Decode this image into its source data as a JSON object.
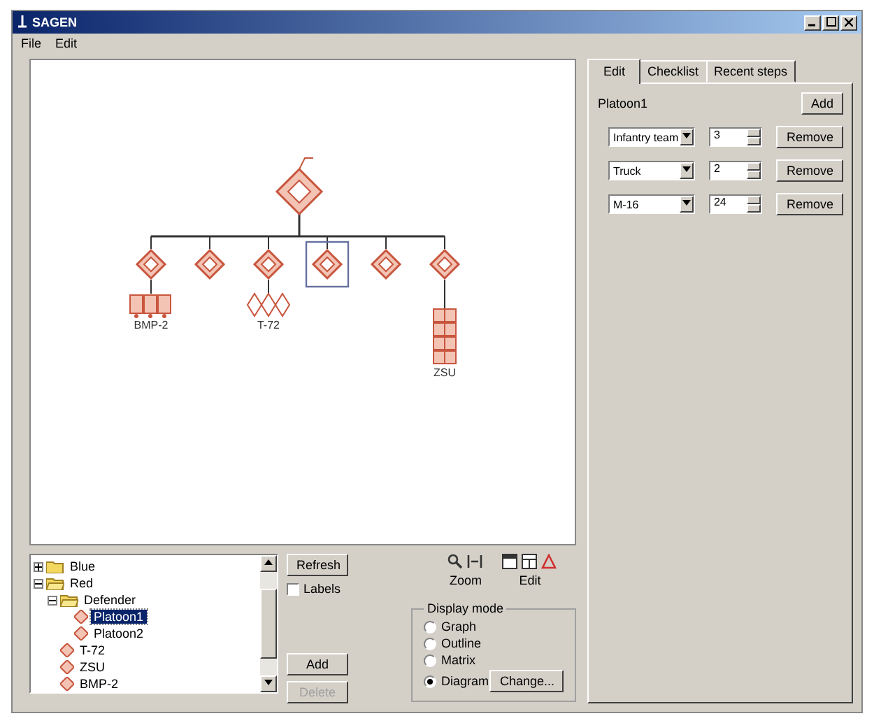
{
  "window": {
    "title": "SAGEN"
  },
  "menu": [
    "File",
    "Edit"
  ],
  "diagram": {
    "root": {
      "selected": false
    },
    "units": [
      {
        "selected": false,
        "attachment": {
          "kind": "rects",
          "label": "BMP-2"
        }
      },
      {
        "selected": false
      },
      {
        "selected": false,
        "attachment": {
          "kind": "diamonds",
          "label": "T-72"
        }
      },
      {
        "selected": true
      },
      {
        "selected": false
      },
      {
        "selected": false,
        "attachment": {
          "kind": "stack",
          "label": "ZSU"
        }
      }
    ]
  },
  "tabs": [
    {
      "label": "Edit",
      "selected": true
    },
    {
      "label": "Checklist",
      "selected": false
    },
    {
      "label": "Recent steps",
      "selected": false
    }
  ],
  "edit": {
    "unit": "Platoon1",
    "add_button": "Add",
    "rows": [
      {
        "type": "Infantry team",
        "count": "3",
        "button": "Remove"
      },
      {
        "type": "Truck",
        "count": "2",
        "button": "Remove"
      },
      {
        "type": "M-16",
        "count": "24",
        "button": "Remove"
      }
    ]
  },
  "tree": [
    {
      "label": "Blue",
      "kind": "folder",
      "expanded": false,
      "selected": false
    },
    {
      "label": "Red",
      "kind": "folder",
      "expanded": true,
      "selected": false,
      "children": [
        {
          "label": "Defender",
          "kind": "folder",
          "expanded": true,
          "selected": false,
          "children": [
            {
              "label": "Platoon1",
              "kind": "unit",
              "selected": true
            },
            {
              "label": "Platoon2",
              "kind": "unit",
              "selected": false
            }
          ]
        },
        {
          "label": "T-72",
          "kind": "unit",
          "selected": false
        },
        {
          "label": "ZSU",
          "kind": "unit",
          "selected": false
        },
        {
          "label": "BMP-2",
          "kind": "unit",
          "selected": false
        }
      ]
    }
  ],
  "controls": {
    "refresh": "Refresh",
    "labels": {
      "label": "Labels",
      "checked": false
    },
    "add": {
      "label": "Add",
      "disabled": false
    },
    "delete": {
      "label": "Delete",
      "disabled": true
    }
  },
  "toolbar": {
    "zoom_label": "Zoom",
    "edit_label": "Edit"
  },
  "display_mode": {
    "title": "Display mode",
    "options": [
      {
        "label": "Graph",
        "selected": false
      },
      {
        "label": "Outline",
        "selected": false
      },
      {
        "label": "Matrix",
        "selected": false
      },
      {
        "label": "Diagram",
        "selected": true
      }
    ],
    "change_button": "Change..."
  }
}
